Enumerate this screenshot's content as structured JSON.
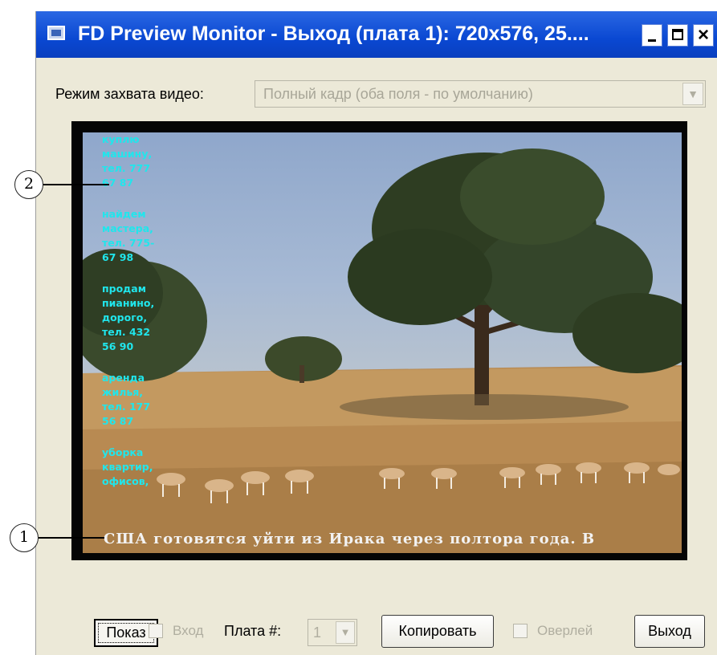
{
  "window": {
    "title": "FD Preview Monitor - Выход (плата 1): 720x576, 25....",
    "minimize_label": "_",
    "maximize_label": "",
    "close_label": "×"
  },
  "capture": {
    "label": "Режим захвата видео:",
    "selected": "Полный кадр (оба поля - по умолчанию)",
    "arrow": "▼",
    "disabled": true
  },
  "preview": {
    "ticker_text": "США готовятся уйти из Ирака через полтора года.   В",
    "crawl_items": [
      "куплю\nмашину,\nтел. 777\n67 87",
      "найдем\nмастера,\nтел. 775-\n67 98",
      "продам\nпианино,\nдорого,\nтел. 432\n56 90",
      "аренда\nжилья,\nтел. 177\n56 87",
      "уборка\nквартир,\nофисов,"
    ]
  },
  "callouts": {
    "one": "1",
    "two": "2"
  },
  "controls": {
    "show_label": "Показ",
    "input_label": "Вход",
    "input_checked": false,
    "board_label": "Плата #:",
    "board_value": "1",
    "board_arrow": "▼",
    "copy_label": "Копировать",
    "overlay_label": "Оверлей",
    "overlay_checked": false,
    "exit_label": "Выход"
  },
  "colors": {
    "titlebar": "#0a48d2",
    "window_bg": "#ece9d8",
    "crawl_text": "#20e6ec",
    "ticker_text": "#f2f2f2"
  }
}
